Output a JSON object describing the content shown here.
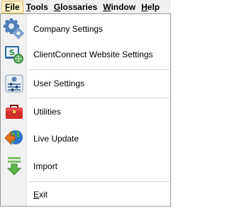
{
  "menubar": {
    "items": [
      {
        "first": "F",
        "rest": "ile",
        "active": true
      },
      {
        "first": "T",
        "rest": "ools",
        "active": false
      },
      {
        "first": "G",
        "rest": "lossaries",
        "active": false
      },
      {
        "first": "W",
        "rest": "indow",
        "active": false
      },
      {
        "first": "H",
        "rest": "elp",
        "active": false
      }
    ]
  },
  "file_menu": {
    "items": [
      {
        "label": "Company Settings",
        "icon": "gear-settings-icon"
      },
      {
        "label": "ClientConnect Website Settings",
        "icon": "website-settings-icon"
      },
      {
        "label": "User Settings",
        "icon": "user-settings-icon"
      },
      {
        "label": "Utilities",
        "icon": "toolbox-icon"
      },
      {
        "label": "Live Update",
        "icon": "globe-update-icon"
      },
      {
        "label": "Import",
        "icon": "import-arrow-icon"
      },
      {
        "exit_first": "E",
        "exit_rest": "xit",
        "icon": ""
      }
    ]
  }
}
